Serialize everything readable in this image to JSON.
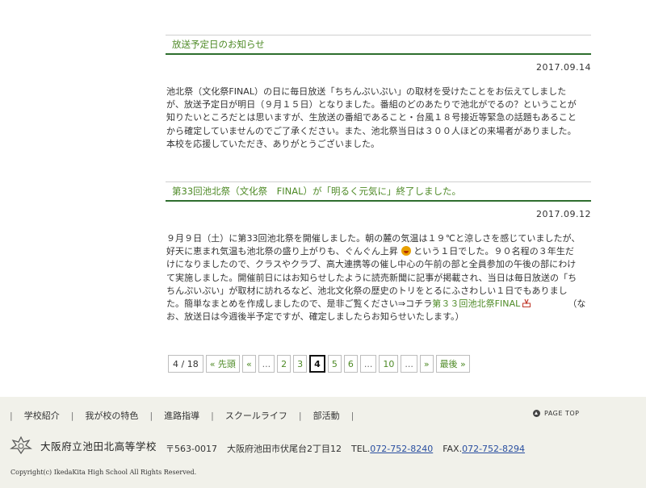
{
  "posts": [
    {
      "title": "放送予定日のお知らせ",
      "date": "2017.09.14",
      "lines": [
        "池北祭（文化祭FINAL）の日に毎日放送「ちちんぷいぷい」の取材を受けたことをお伝えてしました",
        "が、放送予定日が明日（９月１５日）となりました。番組のどのあたりで池北がでるの？ということが",
        "知りたいところだとは思いますが、生放送の番組であること・台風１８号接近等緊急の話題もあること",
        "から確定していませんのでご了承ください。また、池北祭当日は３００人ほどの来場者がありました。",
        "本校を応援していただき、ありがとうございました。"
      ]
    },
    {
      "title": "第33回池北祭（文化祭　FINAL）が「明るく元気に」終了しました。",
      "date": "2017.09.12",
      "line1": "９月９日（土）に第33回池北祭を開催しました。朝の麓の気温は１９℃と涼しさを感じていましたが、",
      "line2a": "好天に恵まれ気温も池北祭の盛り上がりも、ぐんぐん上昇",
      "line2b": "という１日でした。９０名程の３年生だ",
      "line3": "けになりましたので、クラスやクラブ、高大連携等の催し中心の午前の部と全員参加の午後の部にわけ",
      "line4": "て実施しました。開催前日にはお知らせしたように読売新聞に記事が掲載され、当日は毎日放送の「ち",
      "line5": "ちんぷいぷい」が取材に訪れるなど、池北文化祭の歴史のトリをとるにふさわしい１日でもありまし",
      "line6a": "た。簡単なまとめを作成しましたので、是非ご覧ください⇒コチラ",
      "line6link": "第３３回池北祭FINAL",
      "line6b": "（な",
      "line7": "お、放送日は今週後半予定ですが、確定しましたらお知らせいたします。）"
    }
  ],
  "pager": {
    "info": "4 / 18",
    "first": "« 先頭",
    "prev": "«",
    "dots": "...",
    "pages": [
      "2",
      "3",
      "4",
      "5",
      "6"
    ],
    "current": "4",
    "last_page": "10",
    "next": "»",
    "last": "最後 »"
  },
  "footer": {
    "nav": [
      "学校紹介",
      "我が校の特色",
      "進路指導",
      "スクールライフ",
      "部活動"
    ],
    "sep": "|",
    "page_top": "PAGE TOP",
    "school_name": "大阪府立池田北高等学校",
    "postal": "〒563-0017",
    "address": "大阪府池田市伏尾台2丁目12",
    "tel_label": "TEL.",
    "tel": "072-752-8240",
    "fax_label": "FAX.",
    "fax": "072-752-8294",
    "copyright": "Copyright(c) IkedaKita High School All Rights Reserved."
  },
  "colors": {
    "accent": "#4e8a26",
    "rule": "#2e6e2e",
    "footer_bg": "#f1f1ea",
    "link": "#2a4fa0"
  },
  "icons": {
    "emoji": "grinning-face-icon",
    "pdf": "pdf-icon",
    "page_top": "arrow-up-circle-icon",
    "crest": "school-crest-icon"
  }
}
